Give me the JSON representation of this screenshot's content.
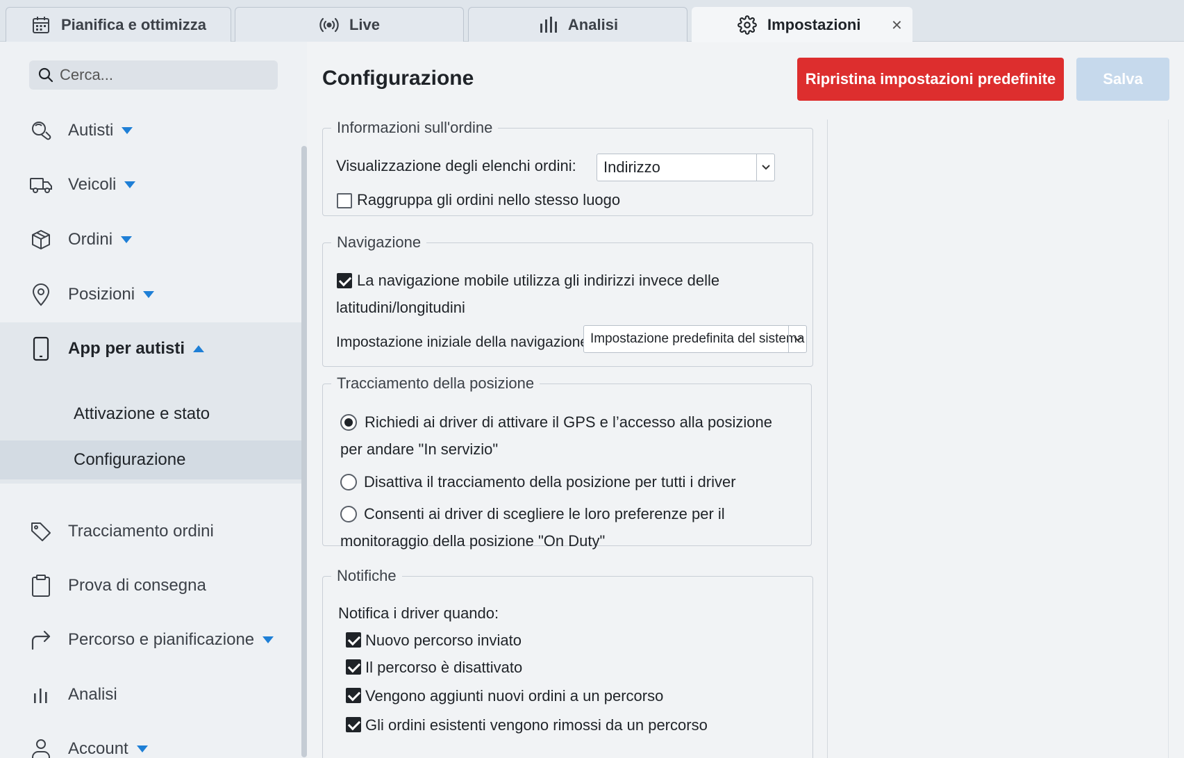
{
  "tabs": [
    {
      "label": "Pianifica e ottimizza",
      "icon": "calendar-icon"
    },
    {
      "label": "Live",
      "icon": "broadcast-icon"
    },
    {
      "label": "Analisi",
      "icon": "bar-chart-icon"
    },
    {
      "label": "Impostazioni",
      "icon": "gear-icon",
      "active": true,
      "close_label": "×"
    }
  ],
  "sidebar": {
    "search_placeholder": "Cerca...",
    "items": [
      {
        "label": "Autisti",
        "icon": "drivers-icon"
      },
      {
        "label": "Veicoli",
        "icon": "truck-icon"
      },
      {
        "label": "Ordini",
        "icon": "package-icon"
      },
      {
        "label": "Posizioni",
        "icon": "map-pin-icon"
      },
      {
        "label": "App per autisti",
        "icon": "phone-icon",
        "expanded": true
      },
      {
        "label": "Tracciamento ordini",
        "icon": "tag-icon"
      },
      {
        "label": "Prova di consegna",
        "icon": "clipboard-icon"
      },
      {
        "label": "Percorso e pianificazione",
        "icon": "route-arrow-icon"
      },
      {
        "label": "Analisi",
        "icon": "bar-chart-icon"
      },
      {
        "label": "Account",
        "icon": "user-icon"
      }
    ],
    "sub_items": [
      {
        "label": "Attivazione e stato"
      },
      {
        "label": "Configurazione",
        "selected": true
      }
    ]
  },
  "main": {
    "title": "Configurazione",
    "reset_label": "Ripristina impostazioni  predefinite",
    "save_label": "Salva",
    "sections": {
      "order_info": {
        "legend": "Informazioni sull'ordine",
        "list_display_label": "Visualizzazione degli elenchi ordini:",
        "list_display_value": "Indirizzo",
        "group_orders_label": "Raggruppa gli ordini nello stesso luogo",
        "group_orders_checked": false
      },
      "navigation": {
        "legend": "Navigazione",
        "use_addresses_label_1": "La navigazione mobile utilizza gli indirizzi invece delle",
        "use_addresses_label_2": "latitudini/longitudini",
        "use_addresses_checked": true,
        "initial_setting_label": "Impostazione iniziale della navigazione:",
        "initial_setting_value": "Impostazione predefinita del sistema"
      },
      "tracking": {
        "legend": "Tracciamento della posizione",
        "options": [
          {
            "line1": "Richiedi ai driver di attivare il GPS e l’accesso alla posizione",
            "line2": "per andare \"In servizio\"",
            "checked": true
          },
          {
            "line1": "Disattiva il tracciamento della posizione per tutti i driver",
            "line2": "",
            "checked": false
          },
          {
            "line1": "Consenti ai driver di scegliere le loro preferenze per il",
            "line2": "monitoraggio della posizione \"On Duty\"",
            "checked": false
          }
        ]
      },
      "notifications": {
        "legend": "Notifiche",
        "intro": "Notifica i driver quando:",
        "options": [
          {
            "label": "Nuovo percorso inviato",
            "checked": true
          },
          {
            "label": "Il percorso è disattivato",
            "checked": true
          },
          {
            "label": "Vengono aggiunti nuovi ordini a un percorso",
            "checked": true
          },
          {
            "label": "Gli ordini esistenti vengono rimossi da un percorso",
            "checked": true
          }
        ]
      }
    }
  },
  "colors": {
    "accent": "#1e7fd6",
    "danger": "#dd2e2e",
    "save_disabled": "#c6d9ec"
  }
}
